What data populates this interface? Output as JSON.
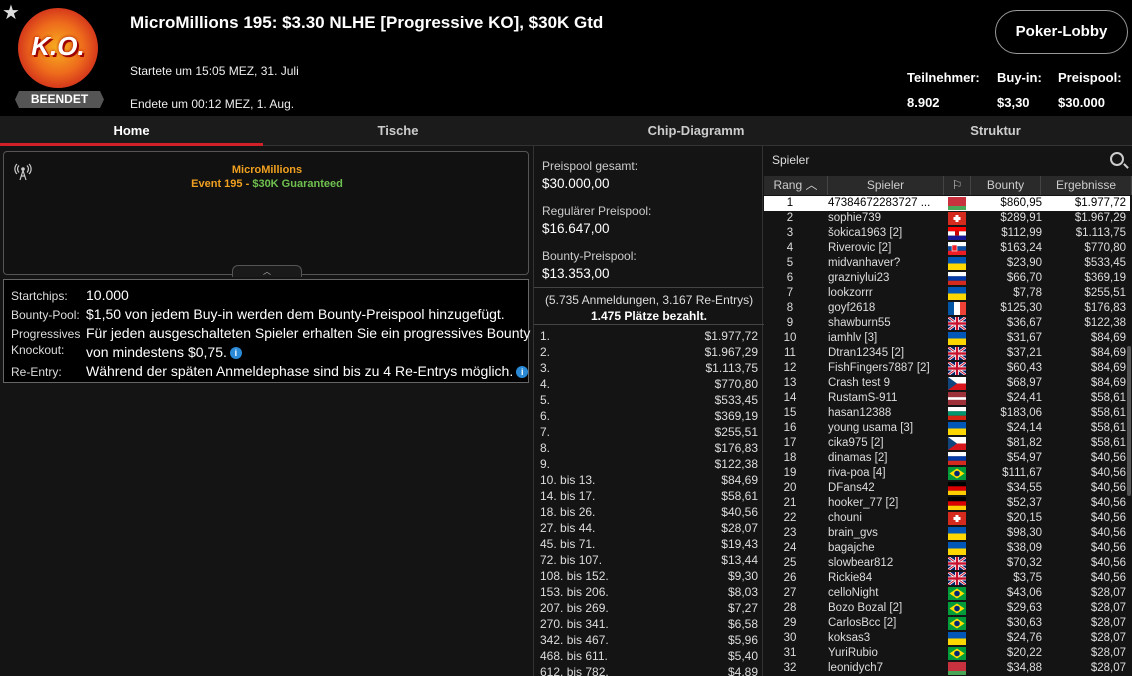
{
  "header": {
    "title": "MicroMillions 195: $3.30 NLHE [Progressive KO], $30K Gtd",
    "started": "Startete um 15:05 MEZ, 31. Juli",
    "ended": "Endete um 00:12 MEZ, 1. Aug.",
    "status": "BEENDET",
    "logo_text": "K.O.",
    "lobby_button": "Poker-Lobby",
    "stats": [
      {
        "label": "Teilnehmer:",
        "value": "8.902"
      },
      {
        "label": "Buy-in:",
        "value": "$3,30"
      },
      {
        "label": "Preispool:",
        "value": "$30.000"
      }
    ]
  },
  "tabs": [
    "Home",
    "Tische",
    "Chip-Diagramm",
    "Struktur"
  ],
  "info": {
    "name": "MicroMillions",
    "event": "Event 195",
    "sep": " - ",
    "guarantee": "$30K Guaranteed"
  },
  "details": [
    {
      "label": "Startchips:",
      "value": "10.000"
    },
    {
      "label": "Bounty-Pool:",
      "value": "$1,50 von jedem Buy-in werden dem Bounty-Preispool hinzugefügt."
    },
    {
      "label": "Progressives",
      "label2": "Knockout:",
      "value": "Für jeden ausgeschalteten Spieler erhalten Sie ein progressives Bounty",
      "value2": "von mindestens $0,75."
    },
    {
      "label": "Re-Entry:",
      "value": "Während der späten Anmeldephase sind bis zu 4 Re-Entrys möglich."
    }
  ],
  "prizepool": [
    {
      "label": "Preispool gesamt:",
      "value": "$30.000,00"
    },
    {
      "label": "Regulärer Preispool:",
      "value": "$16.647,00"
    },
    {
      "label": "Bounty-Preispool:",
      "value": "$13.353,00"
    }
  ],
  "registrations": "(5.735 Anmeldungen, 3.167 Re-Entrys)",
  "paid": "1.475 Plätze bezahlt.",
  "payouts": [
    [
      "1.",
      "$1.977,72"
    ],
    [
      "2.",
      "$1.967,29"
    ],
    [
      "3.",
      "$1.113,75"
    ],
    [
      "4.",
      "$770,80"
    ],
    [
      "5.",
      "$533,45"
    ],
    [
      "6.",
      "$369,19"
    ],
    [
      "7.",
      "$255,51"
    ],
    [
      "8.",
      "$176,83"
    ],
    [
      "9.",
      "$122,38"
    ],
    [
      "10. bis 13.",
      "$84,69"
    ],
    [
      "14. bis 17.",
      "$58,61"
    ],
    [
      "18. bis 26.",
      "$40,56"
    ],
    [
      "27. bis 44.",
      "$28,07"
    ],
    [
      "45. bis 71.",
      "$19,43"
    ],
    [
      "72. bis 107.",
      "$13,44"
    ],
    [
      "108. bis 152.",
      "$9,30"
    ],
    [
      "153. bis 206.",
      "$8,03"
    ],
    [
      "207. bis 269.",
      "$7,27"
    ],
    [
      "270. bis 341.",
      "$6,58"
    ],
    [
      "342. bis 467.",
      "$5,96"
    ],
    [
      "468. bis 611.",
      "$5,40"
    ],
    [
      "612. bis 782.",
      "$4,89"
    ]
  ],
  "players": {
    "search": "Spieler",
    "columns": [
      "Rang",
      "Spieler",
      "Bounty",
      "Ergebnisse"
    ],
    "rows": [
      [
        "1",
        "47384672283727 ...",
        "by",
        "$860,95",
        "$1.977,72"
      ],
      [
        "2",
        "sophie739",
        "ch",
        "$289,91",
        "$1.967,29"
      ],
      [
        "3",
        "šokica1963 [2]",
        "hr",
        "$112,99",
        "$1.113,75"
      ],
      [
        "4",
        "Riverovic [2]",
        "sk",
        "$163,24",
        "$770,80"
      ],
      [
        "5",
        "midvanhaver?",
        "ua",
        "$23,90",
        "$533,45"
      ],
      [
        "6",
        "grazniylui23",
        "ru",
        "$66,70",
        "$369,19"
      ],
      [
        "7",
        "lookzorrr",
        "ua",
        "$7,78",
        "$255,51"
      ],
      [
        "8",
        "goyf2618",
        "fr",
        "$125,30",
        "$176,83"
      ],
      [
        "9",
        "shawburn55",
        "gb",
        "$36,67",
        "$122,38"
      ],
      [
        "10",
        "iamhlv [3]",
        "ua",
        "$31,67",
        "$84,69"
      ],
      [
        "11",
        "Dtran12345 [2]",
        "gb",
        "$37,21",
        "$84,69"
      ],
      [
        "12",
        "FishFingers7887 [2]",
        "gb",
        "$60,43",
        "$84,69"
      ],
      [
        "13",
        "Crash test 9",
        "cz",
        "$68,97",
        "$84,69"
      ],
      [
        "14",
        "RustamS-911",
        "lv",
        "$24,41",
        "$58,61"
      ],
      [
        "15",
        "hasan12388",
        "bg",
        "$183,06",
        "$58,61"
      ],
      [
        "16",
        "young usama [3]",
        "ua",
        "$24,14",
        "$58,61"
      ],
      [
        "17",
        "cika975 [2]",
        "cz",
        "$81,82",
        "$58,61"
      ],
      [
        "18",
        "dinamas [2]",
        "ru",
        "$54,97",
        "$40,56"
      ],
      [
        "19",
        "riva-poa [4]",
        "br",
        "$111,67",
        "$40,56"
      ],
      [
        "20",
        "DFans42",
        "de",
        "$34,55",
        "$40,56"
      ],
      [
        "21",
        "hooker_77 [2]",
        "de",
        "$52,37",
        "$40,56"
      ],
      [
        "22",
        "chouni",
        "ch",
        "$20,15",
        "$40,56"
      ],
      [
        "23",
        "brain_gvs",
        "ua",
        "$98,30",
        "$40,56"
      ],
      [
        "24",
        "bagajche",
        "ua",
        "$38,09",
        "$40,56"
      ],
      [
        "25",
        "slowbear812",
        "gb",
        "$70,32",
        "$40,56"
      ],
      [
        "26",
        "Rickie84",
        "gb",
        "$3,75",
        "$40,56"
      ],
      [
        "27",
        "celloNight",
        "br",
        "$43,06",
        "$28,07"
      ],
      [
        "28",
        "Bozo Bozal [2]",
        "br",
        "$29,63",
        "$28,07"
      ],
      [
        "29",
        "CarlosBcc [2]",
        "br",
        "$30,63",
        "$28,07"
      ],
      [
        "30",
        "koksas3",
        "ua",
        "$24,76",
        "$28,07"
      ],
      [
        "31",
        "YuriRubio",
        "br",
        "$20,22",
        "$28,07"
      ],
      [
        "32",
        "leonidych7",
        "by",
        "$34,88",
        "$28,07"
      ]
    ]
  }
}
